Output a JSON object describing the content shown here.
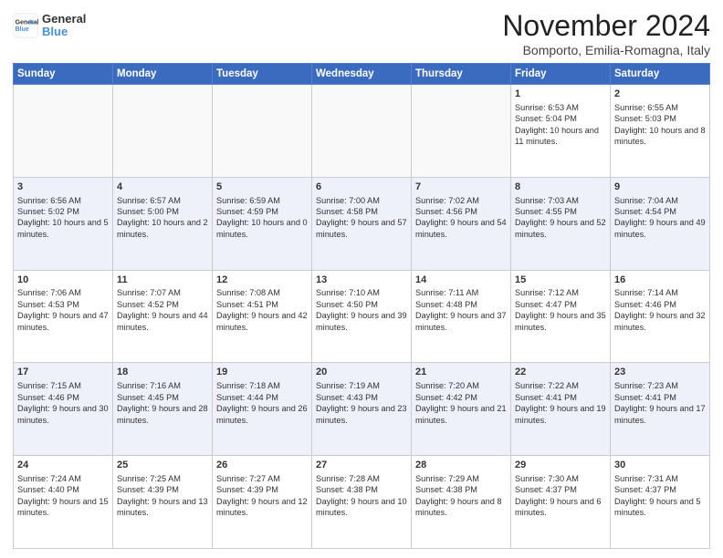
{
  "header": {
    "logo_line1": "General",
    "logo_line2": "Blue",
    "month_title": "November 2024",
    "subtitle": "Bomporto, Emilia-Romagna, Italy"
  },
  "days_of_week": [
    "Sunday",
    "Monday",
    "Tuesday",
    "Wednesday",
    "Thursday",
    "Friday",
    "Saturday"
  ],
  "weeks": [
    [
      {
        "num": "",
        "info": ""
      },
      {
        "num": "",
        "info": ""
      },
      {
        "num": "",
        "info": ""
      },
      {
        "num": "",
        "info": ""
      },
      {
        "num": "",
        "info": ""
      },
      {
        "num": "1",
        "info": "Sunrise: 6:53 AM\nSunset: 5:04 PM\nDaylight: 10 hours and 11 minutes."
      },
      {
        "num": "2",
        "info": "Sunrise: 6:55 AM\nSunset: 5:03 PM\nDaylight: 10 hours and 8 minutes."
      }
    ],
    [
      {
        "num": "3",
        "info": "Sunrise: 6:56 AM\nSunset: 5:02 PM\nDaylight: 10 hours and 5 minutes."
      },
      {
        "num": "4",
        "info": "Sunrise: 6:57 AM\nSunset: 5:00 PM\nDaylight: 10 hours and 2 minutes."
      },
      {
        "num": "5",
        "info": "Sunrise: 6:59 AM\nSunset: 4:59 PM\nDaylight: 10 hours and 0 minutes."
      },
      {
        "num": "6",
        "info": "Sunrise: 7:00 AM\nSunset: 4:58 PM\nDaylight: 9 hours and 57 minutes."
      },
      {
        "num": "7",
        "info": "Sunrise: 7:02 AM\nSunset: 4:56 PM\nDaylight: 9 hours and 54 minutes."
      },
      {
        "num": "8",
        "info": "Sunrise: 7:03 AM\nSunset: 4:55 PM\nDaylight: 9 hours and 52 minutes."
      },
      {
        "num": "9",
        "info": "Sunrise: 7:04 AM\nSunset: 4:54 PM\nDaylight: 9 hours and 49 minutes."
      }
    ],
    [
      {
        "num": "10",
        "info": "Sunrise: 7:06 AM\nSunset: 4:53 PM\nDaylight: 9 hours and 47 minutes."
      },
      {
        "num": "11",
        "info": "Sunrise: 7:07 AM\nSunset: 4:52 PM\nDaylight: 9 hours and 44 minutes."
      },
      {
        "num": "12",
        "info": "Sunrise: 7:08 AM\nSunset: 4:51 PM\nDaylight: 9 hours and 42 minutes."
      },
      {
        "num": "13",
        "info": "Sunrise: 7:10 AM\nSunset: 4:50 PM\nDaylight: 9 hours and 39 minutes."
      },
      {
        "num": "14",
        "info": "Sunrise: 7:11 AM\nSunset: 4:48 PM\nDaylight: 9 hours and 37 minutes."
      },
      {
        "num": "15",
        "info": "Sunrise: 7:12 AM\nSunset: 4:47 PM\nDaylight: 9 hours and 35 minutes."
      },
      {
        "num": "16",
        "info": "Sunrise: 7:14 AM\nSunset: 4:46 PM\nDaylight: 9 hours and 32 minutes."
      }
    ],
    [
      {
        "num": "17",
        "info": "Sunrise: 7:15 AM\nSunset: 4:46 PM\nDaylight: 9 hours and 30 minutes."
      },
      {
        "num": "18",
        "info": "Sunrise: 7:16 AM\nSunset: 4:45 PM\nDaylight: 9 hours and 28 minutes."
      },
      {
        "num": "19",
        "info": "Sunrise: 7:18 AM\nSunset: 4:44 PM\nDaylight: 9 hours and 26 minutes."
      },
      {
        "num": "20",
        "info": "Sunrise: 7:19 AM\nSunset: 4:43 PM\nDaylight: 9 hours and 23 minutes."
      },
      {
        "num": "21",
        "info": "Sunrise: 7:20 AM\nSunset: 4:42 PM\nDaylight: 9 hours and 21 minutes."
      },
      {
        "num": "22",
        "info": "Sunrise: 7:22 AM\nSunset: 4:41 PM\nDaylight: 9 hours and 19 minutes."
      },
      {
        "num": "23",
        "info": "Sunrise: 7:23 AM\nSunset: 4:41 PM\nDaylight: 9 hours and 17 minutes."
      }
    ],
    [
      {
        "num": "24",
        "info": "Sunrise: 7:24 AM\nSunset: 4:40 PM\nDaylight: 9 hours and 15 minutes."
      },
      {
        "num": "25",
        "info": "Sunrise: 7:25 AM\nSunset: 4:39 PM\nDaylight: 9 hours and 13 minutes."
      },
      {
        "num": "26",
        "info": "Sunrise: 7:27 AM\nSunset: 4:39 PM\nDaylight: 9 hours and 12 minutes."
      },
      {
        "num": "27",
        "info": "Sunrise: 7:28 AM\nSunset: 4:38 PM\nDaylight: 9 hours and 10 minutes."
      },
      {
        "num": "28",
        "info": "Sunrise: 7:29 AM\nSunset: 4:38 PM\nDaylight: 9 hours and 8 minutes."
      },
      {
        "num": "29",
        "info": "Sunrise: 7:30 AM\nSunset: 4:37 PM\nDaylight: 9 hours and 6 minutes."
      },
      {
        "num": "30",
        "info": "Sunrise: 7:31 AM\nSunset: 4:37 PM\nDaylight: 9 hours and 5 minutes."
      }
    ]
  ]
}
